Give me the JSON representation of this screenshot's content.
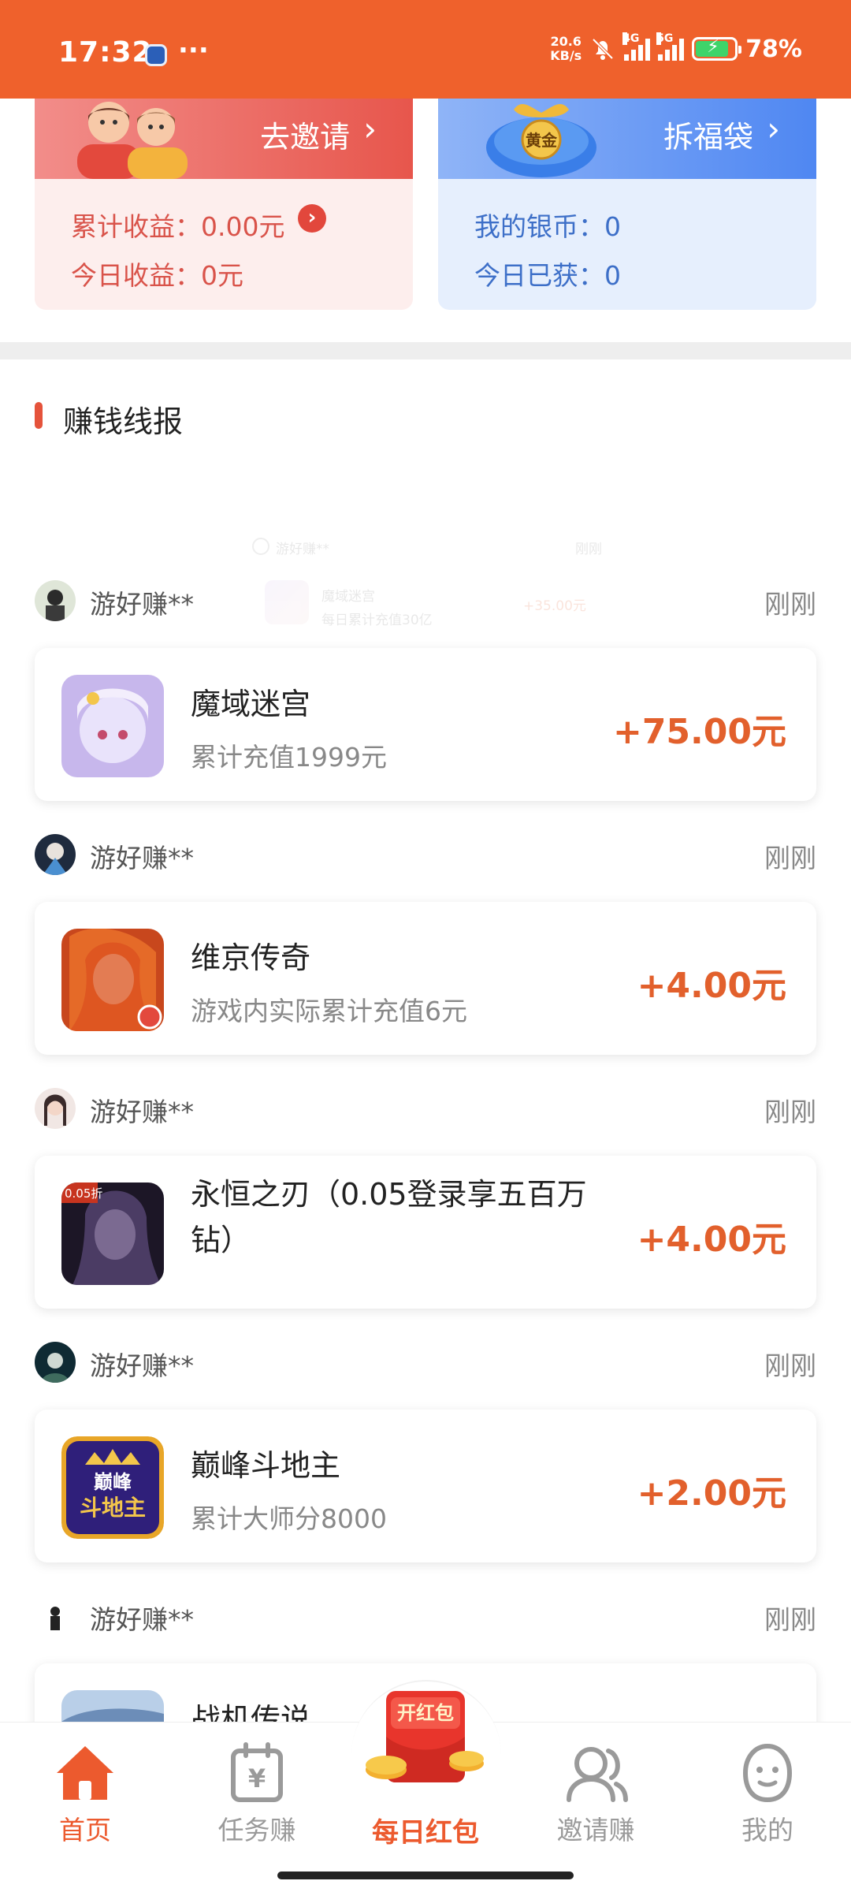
{
  "status_bar": {
    "time": "17:32",
    "dots": "···",
    "speed_top": "20.6",
    "speed_bottom": "KB/s",
    "net1": "4G",
    "net2": "5G",
    "battery": "78%",
    "battery_level": 0.78,
    "icons": [
      "app-notification-icon",
      "mute-bell-icon",
      "signal-icon",
      "battery-charging-icon"
    ]
  },
  "invite_card": {
    "button_label": "去邀请",
    "total_earnings": "累计收益：0.00元",
    "today_earnings": "今日收益：0元"
  },
  "lucky_bag_card": {
    "button_label": "拆福袋",
    "badge": "黄金",
    "silver_coins": "我的银币：0",
    "today_gained": "今日已获：0"
  },
  "section": {
    "title": "赚钱线报"
  },
  "ghost_row": {
    "username": "游好赚**",
    "time": "刚刚",
    "game": "魔域迷宫",
    "desc": "每日累计充值30亿",
    "reward": "+35.00元"
  },
  "feed": [
    {
      "username": "游好赚**",
      "time": "刚刚",
      "game": "魔域迷宫",
      "desc": "累计充值1999元",
      "reward": "+75.00元"
    },
    {
      "username": "游好赚**",
      "time": "刚刚",
      "game": "维京传奇",
      "desc": "游戏内实际累计充值6元",
      "reward": "+4.00元"
    },
    {
      "username": "游好赚**",
      "time": "刚刚",
      "game": "永恒之刃（0.05登录享五百万钻）",
      "desc": "",
      "reward": "+4.00元",
      "icon_tag": "0.05折"
    },
    {
      "username": "游好赚**",
      "time": "刚刚",
      "game": "巅峰斗地主",
      "desc": "累计大师分8000",
      "reward": "+2.00元",
      "icon_text_1": "巅峰",
      "icon_text_2": "斗地主"
    },
    {
      "username": "游好赚**",
      "time": "刚刚",
      "game": "战机传说",
      "desc": "",
      "reward": ""
    }
  ],
  "bottom_nav": {
    "items": [
      {
        "label": "首页",
        "icon": "home-icon",
        "active": true
      },
      {
        "label": "任务赚",
        "icon": "task-calendar-icon",
        "active": false
      },
      {
        "label": "每日红包",
        "icon": "red-envelope-icon",
        "active": false,
        "badge": "开红包"
      },
      {
        "label": "邀请赚",
        "icon": "invite-users-icon",
        "active": false
      },
      {
        "label": "我的",
        "icon": "profile-icon",
        "active": false
      }
    ]
  },
  "colors": {
    "brand": "#ef612c",
    "reward": "#e2602c",
    "invite_red": "#e7564c",
    "bag_blue": "#4f87f2"
  }
}
